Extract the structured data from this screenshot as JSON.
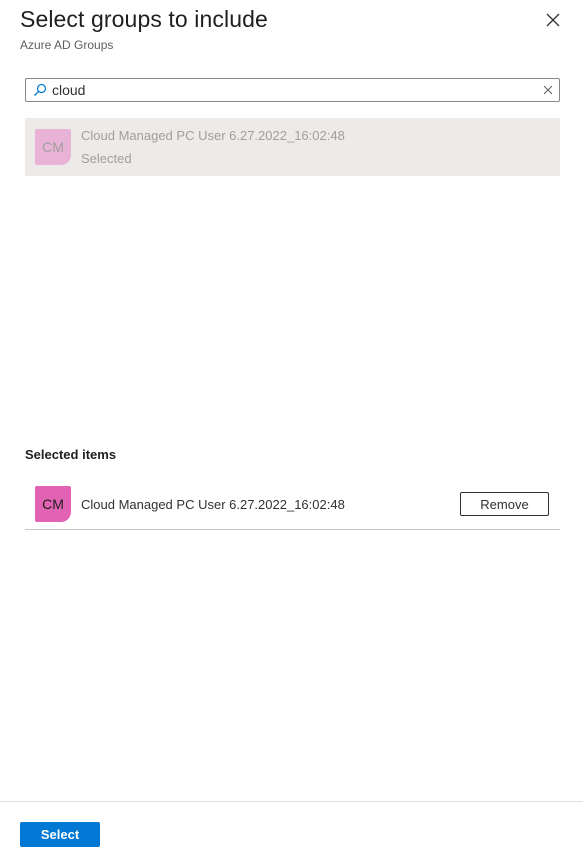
{
  "header": {
    "title": "Select groups to include",
    "subtitle": "Azure AD Groups",
    "close_icon": "close-icon"
  },
  "search": {
    "value": "cloud",
    "icon": "search-icon",
    "clear_icon": "clear-icon"
  },
  "results": [
    {
      "initials": "CM",
      "name": "Cloud Managed PC User 6.27.2022_16:02:48",
      "status": "Selected"
    }
  ],
  "selected": {
    "heading": "Selected items",
    "items": [
      {
        "initials": "CM",
        "name": "Cloud Managed PC User 6.27.2022_16:02:48",
        "remove_label": "Remove"
      }
    ]
  },
  "footer": {
    "select_label": "Select"
  },
  "colors": {
    "accent": "#0078d4",
    "avatar": "#e262b4",
    "avatar_faded": "#e8b3d6",
    "selected_row_bg": "#edebe9"
  }
}
